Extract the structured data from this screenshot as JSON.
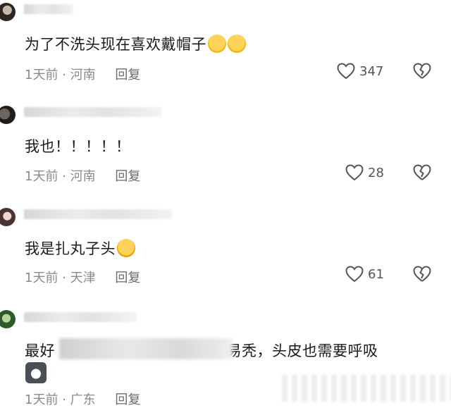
{
  "comments": [
    {
      "text": "为了不洗头现在喜欢戴帽子",
      "time": "1天前",
      "sep": "·",
      "location": "河南",
      "reply_label": "回复",
      "likes": "347",
      "emojis": [
        "face-holding-back-tears-icon",
        "face-holding-back-tears-icon"
      ]
    },
    {
      "text": "我也！！！！！",
      "time": "1天前",
      "sep": "·",
      "location": "河南",
      "reply_label": "回复",
      "likes": "28"
    },
    {
      "text": "我是扎丸子头",
      "time": "1天前",
      "sep": "·",
      "location": "天津",
      "reply_label": "回复",
      "likes": "61",
      "emojis": [
        "rolling-on-floor-laughing-icon"
      ]
    },
    {
      "text_start": "最好",
      "text_end": "容易秃，头皮也需要呼吸",
      "time": "1天前",
      "sep": "·",
      "location": "广东",
      "reply_label": "回复",
      "sticker": "husky-dog-icon"
    }
  ],
  "colors": {
    "meta": "#8a8a8a",
    "text": "#1a1a1a",
    "background": "#ffffff"
  }
}
